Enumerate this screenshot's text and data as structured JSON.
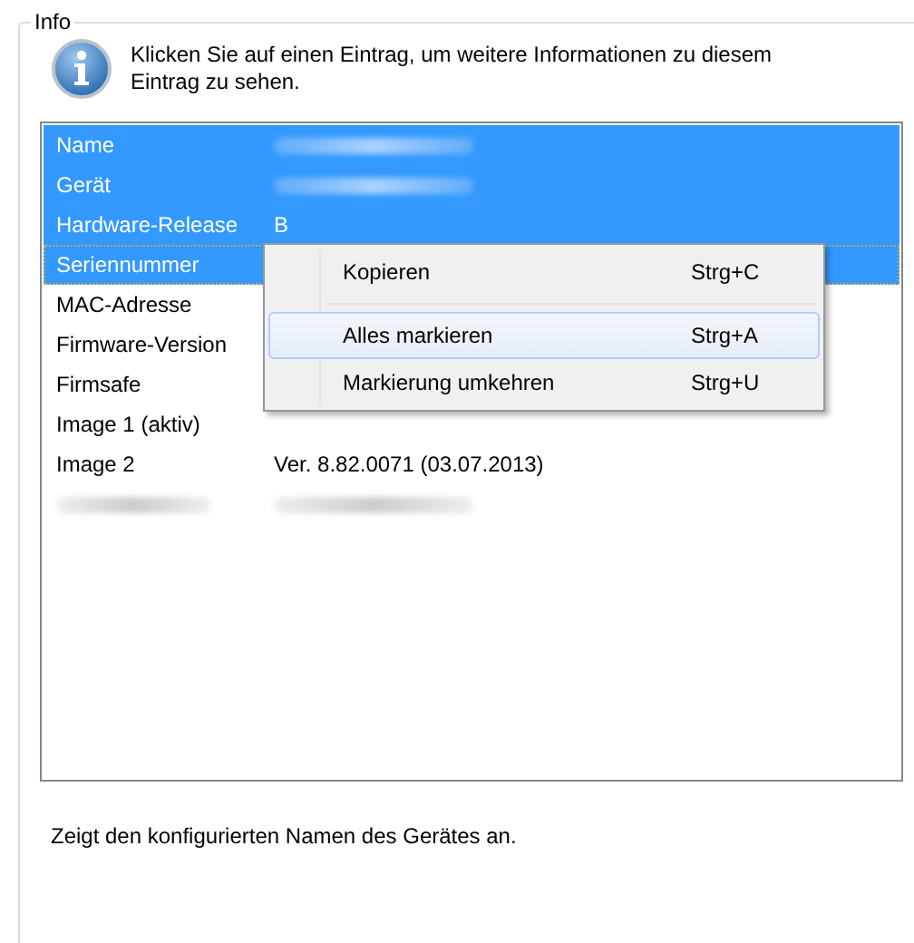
{
  "group": {
    "title": "Info"
  },
  "hint": "Klicken Sie auf einen Eintrag, um weitere Informationen zu diesem Eintrag zu sehen.",
  "rows": [
    {
      "label": "Name",
      "label_blurred": false,
      "value_blurred": true,
      "selected": true,
      "focused": false
    },
    {
      "label": "Gerät",
      "label_blurred": false,
      "value_blurred": true,
      "selected": true,
      "focused": false
    },
    {
      "label": "Hardware-Release",
      "value": "B",
      "label_blurred": false,
      "value_blurred": false,
      "selected": true,
      "focused": false
    },
    {
      "label": "Seriennummer",
      "label_blurred": false,
      "selected": true,
      "focused": true
    },
    {
      "label": "MAC-Adresse",
      "label_blurred": false,
      "selected": false,
      "focused": false
    },
    {
      "label": "Firmware-Version",
      "label_blurred": false,
      "selected": false,
      "focused": false
    },
    {
      "label": "Firmsafe",
      "label_blurred": false,
      "selected": false,
      "focused": false
    },
    {
      "label": "Image 1 (aktiv)",
      "label_blurred": false,
      "selected": false,
      "focused": false
    },
    {
      "label": "Image 2",
      "value": "Ver. 8.82.0071 (03.07.2013)",
      "label_blurred": false,
      "value_blurred": false,
      "selected": false,
      "focused": false
    },
    {
      "label_blurred": true,
      "value_blurred": true,
      "selected": false,
      "focused": false
    }
  ],
  "context_menu": [
    {
      "kind": "item",
      "label": "Kopieren",
      "shortcut": "Strg+C",
      "selected": false
    },
    {
      "kind": "separator"
    },
    {
      "kind": "item",
      "label": "Alles markieren",
      "shortcut": "Strg+A",
      "selected": true
    },
    {
      "kind": "item",
      "label": "Markierung umkehren",
      "shortcut": "Strg+U",
      "selected": false
    }
  ],
  "description": "Zeigt den konfigurierten Namen des Gerätes an."
}
